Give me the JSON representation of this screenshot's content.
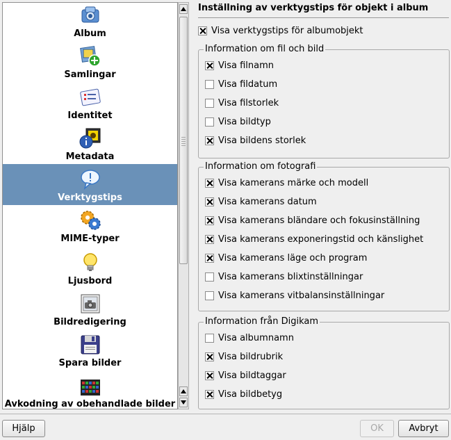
{
  "nav": {
    "items": [
      {
        "label": "Album",
        "icon": "album-icon"
      },
      {
        "label": "Samlingar",
        "icon": "collections-icon"
      },
      {
        "label": "Identitet",
        "icon": "identity-icon"
      },
      {
        "label": "Metadata",
        "icon": "metadata-icon"
      },
      {
        "label": "Verktygstips",
        "icon": "tooltip-icon",
        "selected": true
      },
      {
        "label": "MIME-typer",
        "icon": "mime-types-icon"
      },
      {
        "label": "Ljusbord",
        "icon": "lightbulb-icon"
      },
      {
        "label": "Bildredigering",
        "icon": "image-editor-icon"
      },
      {
        "label": "Spara bilder",
        "icon": "floppy-disk-icon"
      },
      {
        "label": "Avkodning av obehandlade bilder",
        "icon": "raw-decoding-icon"
      }
    ]
  },
  "panel": {
    "title": "Inställning av verktygstips för objekt i album",
    "show_tooltips": {
      "label": "Visa verktygstips för albumobjekt",
      "checked": true
    }
  },
  "groups": {
    "file": {
      "title": "Information om fil och bild",
      "options": [
        {
          "label": "Visa filnamn",
          "checked": true
        },
        {
          "label": "Visa fildatum",
          "checked": false
        },
        {
          "label": "Visa filstorlek",
          "checked": false
        },
        {
          "label": "Visa bildtyp",
          "checked": false
        },
        {
          "label": "Visa bildens storlek",
          "checked": true
        }
      ]
    },
    "photo": {
      "title": "Information om fotografi",
      "options": [
        {
          "label": "Visa kamerans märke och modell",
          "checked": true
        },
        {
          "label": "Visa kamerans datum",
          "checked": true
        },
        {
          "label": "Visa kamerans bländare och fokusinställning",
          "checked": true
        },
        {
          "label": "Visa kamerans exponeringstid och känslighet",
          "checked": true
        },
        {
          "label": "Visa kamerans läge och program",
          "checked": true
        },
        {
          "label": "Visa kamerans blixtinställningar",
          "checked": false
        },
        {
          "label": "Visa kamerans vitbalansinställningar",
          "checked": false
        }
      ]
    },
    "digikam": {
      "title": "Information från Digikam",
      "options": [
        {
          "label": "Visa albumnamn",
          "checked": false
        },
        {
          "label": "Visa bildrubrik",
          "checked": true
        },
        {
          "label": "Visa bildtaggar",
          "checked": true
        },
        {
          "label": "Visa bildbetyg",
          "checked": true
        }
      ]
    }
  },
  "buttons": {
    "help": "Hjälp",
    "ok": "OK",
    "cancel": "Avbryt"
  },
  "colors": {
    "selection": "#6a91b8",
    "background": "#efefef"
  }
}
